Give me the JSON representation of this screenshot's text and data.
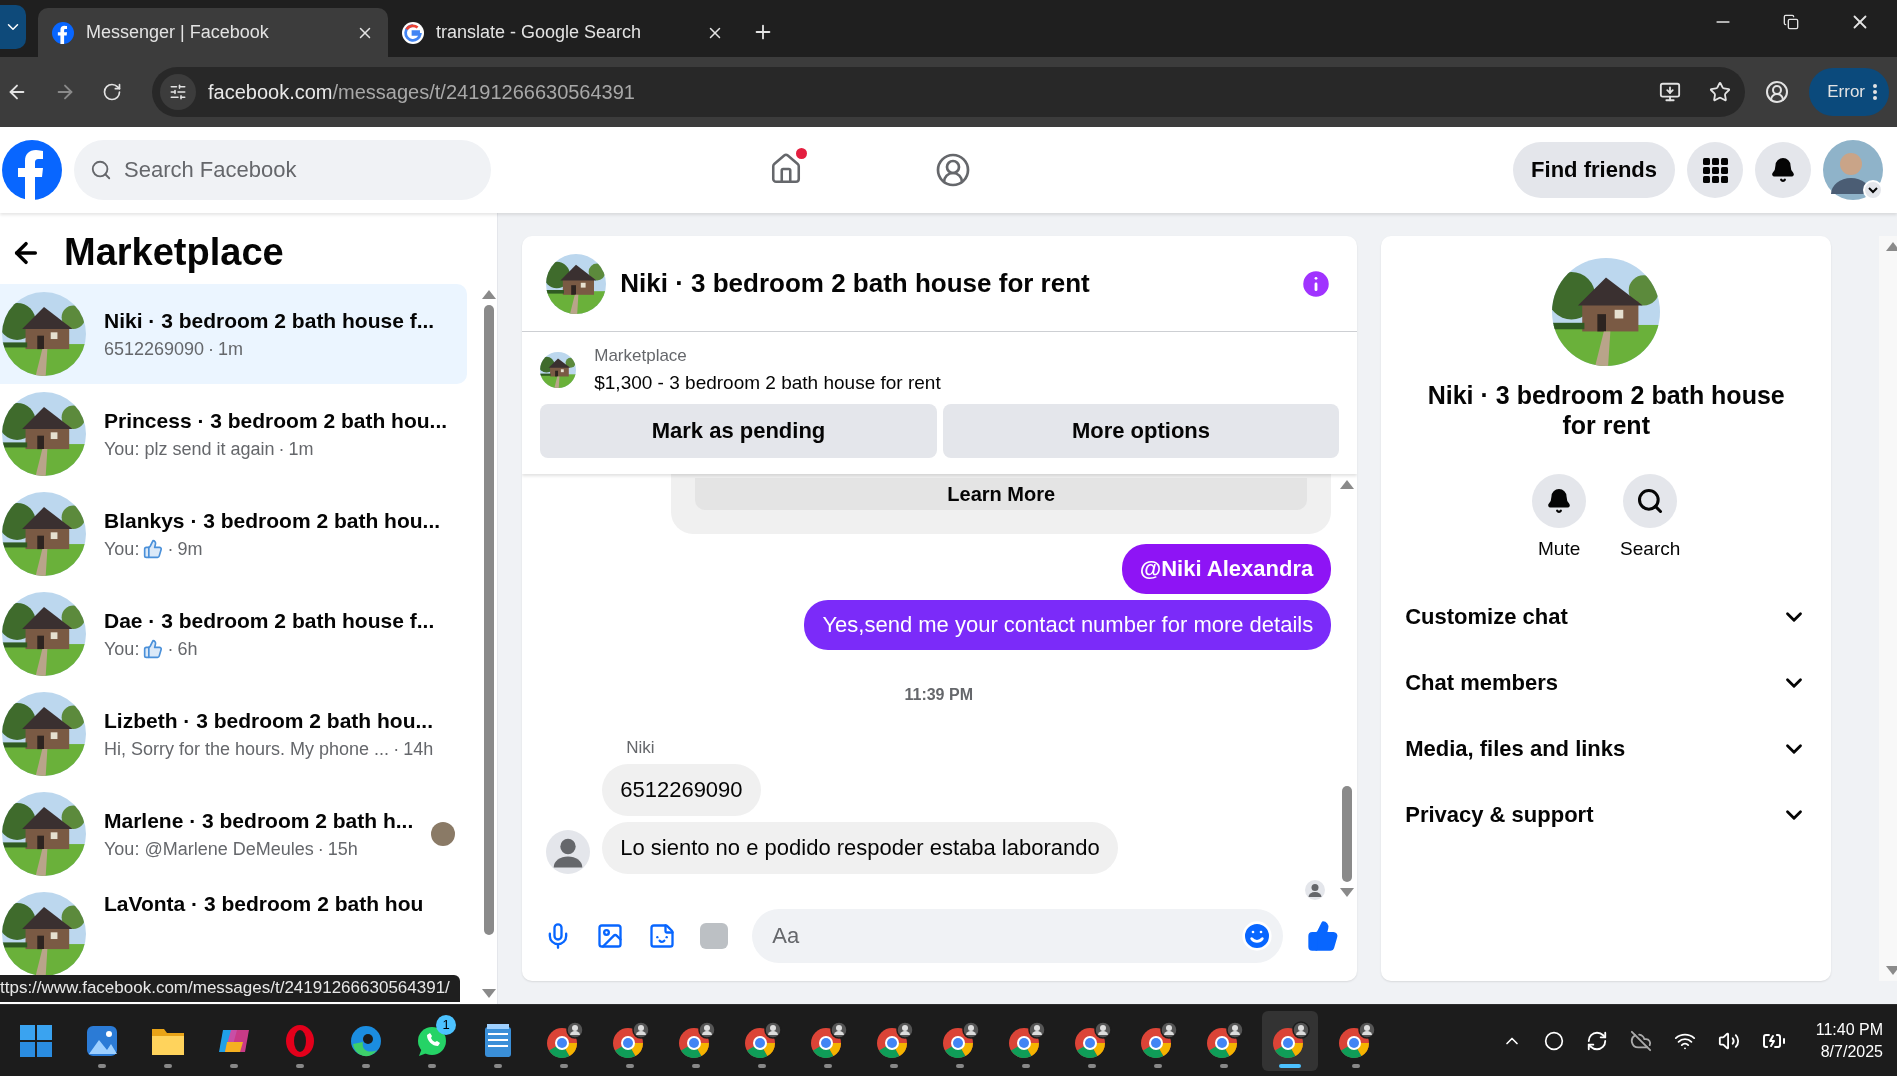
{
  "browser": {
    "tabs": [
      {
        "title": "Messenger | Facebook",
        "selected": true
      },
      {
        "title": "translate - Google Search",
        "selected": false
      }
    ],
    "url_domain": "facebook.com",
    "url_path": "/messages/t/24191266630564391",
    "profile_button": "Error"
  },
  "header": {
    "search_placeholder": "Search Facebook",
    "home_notification": true,
    "find_friends": "Find friends"
  },
  "sidebar": {
    "title": "Marketplace",
    "conversations": [
      {
        "name": "Niki · 3 bedroom 2 bath house f...",
        "preview": "6512269090",
        "like": false,
        "separator": "·",
        "time": "1m",
        "seen": false,
        "selected": true
      },
      {
        "name": "Princess · 3 bedroom 2 bath hou...",
        "preview": "You: plz send it again",
        "like": false,
        "separator": "·",
        "time": "1m",
        "seen": false,
        "selected": false
      },
      {
        "name": "Blankys · 3 bedroom 2 bath hou...",
        "preview": "You:",
        "like": true,
        "separator": "·",
        "time": "9m",
        "seen": false,
        "selected": false
      },
      {
        "name": "Dae · 3 bedroom 2 bath house f...",
        "preview": "You:",
        "like": true,
        "separator": "·",
        "time": "6h",
        "seen": false,
        "selected": false
      },
      {
        "name": "Lizbeth · 3 bedroom 2 bath hou...",
        "preview": "Hi, Sorry for the hours. My phone ...",
        "like": false,
        "separator": "·",
        "time": "14h",
        "seen": false,
        "selected": false
      },
      {
        "name": "Marlene · 3 bedroom 2 bath h...",
        "preview": "You: @Marlene DeMeules",
        "like": false,
        "separator": "·",
        "time": "15h",
        "seen": true,
        "selected": false
      },
      {
        "name": "LaVonta · 3 bedroom 2 bath hou",
        "selected": false
      }
    ],
    "status_link": "ttps://www.facebook.com/messages/t/24191266630564391/"
  },
  "chat": {
    "title": "Niki · 3 bedroom 2 bath house for rent",
    "listing": {
      "source": "Marketplace",
      "summary": "$1,300 - 3 bedroom 2 bath house for rent"
    },
    "actions": [
      "Mark as pending",
      "More options"
    ],
    "messages": [
      {
        "kind": "card_button",
        "text": "Learn More"
      },
      {
        "kind": "outgoing",
        "text": "@Niki Alexandra",
        "bold": true
      },
      {
        "kind": "outgoing",
        "text": "Yes,send me your contact number for more details",
        "bold": false
      },
      {
        "kind": "timestamp",
        "text": "11:39 PM"
      },
      {
        "kind": "sender",
        "text": "Niki"
      },
      {
        "kind": "incoming",
        "text": "6512269090",
        "avatar": false
      },
      {
        "kind": "incoming",
        "text": "Lo siento no e podido respoder estaba laborando",
        "avatar": true
      },
      {
        "kind": "seen"
      }
    ],
    "composer_placeholder": "Aa"
  },
  "details": {
    "title": "Niki · 3 bedroom 2 bath house for rent",
    "actions": [
      {
        "label": "Mute"
      },
      {
        "label": "Search"
      }
    ],
    "sections": [
      {
        "label": "Customize chat",
        "expanded": false
      },
      {
        "label": "Chat members",
        "expanded": false
      },
      {
        "label": "Media, files and links",
        "expanded": false
      },
      {
        "label": "Privacy & support",
        "expanded": false
      }
    ]
  },
  "taskbar": {
    "apps": [
      {
        "kind": "windows",
        "selected": false
      },
      {
        "kind": "photos",
        "selected": false
      },
      {
        "kind": "files",
        "selected": false
      },
      {
        "kind": "copilot",
        "selected": false
      },
      {
        "kind": "opera",
        "selected": false
      },
      {
        "kind": "edge",
        "selected": false
      },
      {
        "kind": "whatsapp",
        "selected": false,
        "badge": "1"
      },
      {
        "kind": "notepad",
        "selected": false
      },
      {
        "kind": "chrome",
        "selected": false
      },
      {
        "kind": "chrome",
        "selected": false
      },
      {
        "kind": "chrome",
        "selected": false
      },
      {
        "kind": "chrome",
        "selected": false
      },
      {
        "kind": "chrome",
        "selected": false
      },
      {
        "kind": "chrome",
        "selected": false
      },
      {
        "kind": "chrome",
        "selected": false
      },
      {
        "kind": "chrome",
        "selected": false
      },
      {
        "kind": "chrome",
        "selected": false
      },
      {
        "kind": "chrome",
        "selected": false
      },
      {
        "kind": "chrome",
        "selected": false
      },
      {
        "kind": "chrome",
        "selected": true
      },
      {
        "kind": "chrome",
        "selected": false
      }
    ],
    "time": "11:40 PM",
    "date": "8/7/2025"
  }
}
